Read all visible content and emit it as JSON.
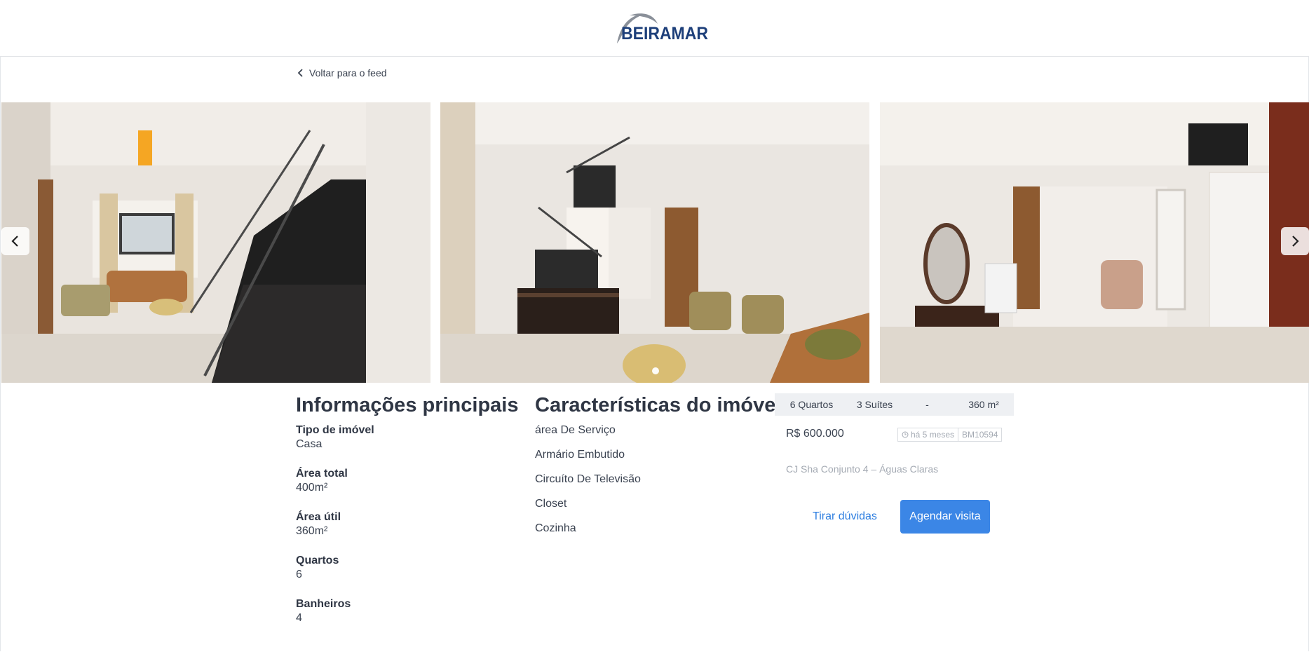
{
  "header": {
    "logo_text": "BEIRAMAR",
    "logo_icon": "swoosh-logo",
    "brand_color": "#1d3f7a"
  },
  "nav": {
    "back_label": "Voltar para o feed",
    "back_icon": "chevron-left-icon"
  },
  "gallery": {
    "photos": [
      {
        "alt": "staircase-living-room"
      },
      {
        "alt": "living-room-tv"
      },
      {
        "alt": "bedroom-dresser"
      }
    ],
    "prev_icon": "chevron-left-icon",
    "next_icon": "chevron-right-icon"
  },
  "main_info": {
    "title": "Informações principais",
    "items": [
      {
        "label": "Tipo de imóvel",
        "value": "Casa"
      },
      {
        "label": "Área total",
        "value": "400m²"
      },
      {
        "label": "Área útil",
        "value": "360m²"
      },
      {
        "label": "Quartos",
        "value": "6"
      },
      {
        "label": "Banheiros",
        "value": "4"
      }
    ]
  },
  "features": {
    "title": "Características do imóvel",
    "items": [
      "área De Serviço",
      "Armário Embutido",
      "Circuíto De Televisão",
      "Closet",
      "Cozinha"
    ]
  },
  "summary": {
    "stats": [
      "6 Quartos",
      "3 Suítes",
      "-",
      "360 m²"
    ],
    "price": "R$ 600.000",
    "age": "há 5 meses",
    "age_icon": "clock-icon",
    "code": "BM10594",
    "address": "CJ Sha Conjunto 4 – Águas Claras",
    "ask_label": "Tirar dúvidas",
    "visit_label": "Agendar visita",
    "accent_color": "#3b86e6"
  }
}
